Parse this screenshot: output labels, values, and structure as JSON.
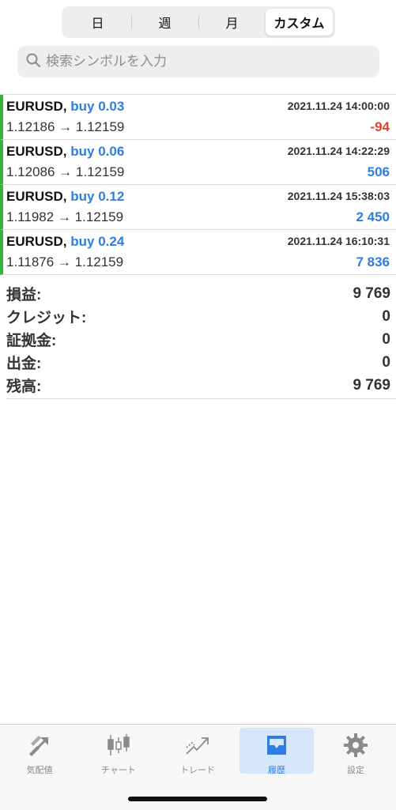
{
  "period_tabs": [
    "日",
    "週",
    "月",
    "カスタム"
  ],
  "search": {
    "placeholder": "検索シンボルを入力"
  },
  "trades": [
    {
      "symbol": "EURUSD,",
      "direction": "buy 0.03",
      "time": "2021.11.24 14:00:00",
      "prices": "1.12186 → 1.12159",
      "profit": "-94"
    },
    {
      "symbol": "EURUSD,",
      "direction": "buy 0.06",
      "time": "2021.11.24 14:22:29",
      "prices": "1.12086 → 1.12159",
      "profit": "506"
    },
    {
      "symbol": "EURUSD,",
      "direction": "buy 0.12",
      "time": "2021.11.24 15:38:03",
      "prices": "1.11982 → 1.12159",
      "profit": "2 450"
    },
    {
      "symbol": "EURUSD,",
      "direction": "buy 0.24",
      "time": "2021.11.24 16:10:31",
      "prices": "1.11876 → 1.12159",
      "profit": "7 836"
    }
  ],
  "summary": [
    {
      "label": "損益:",
      "value": "9 769"
    },
    {
      "label": "クレジット:",
      "value": "0"
    },
    {
      "label": "証拠金:",
      "value": "0"
    },
    {
      "label": "出金:",
      "value": "0"
    },
    {
      "label": "残高:",
      "value": "9 769"
    }
  ],
  "tabbar": [
    {
      "label": "気配値",
      "icon": "quotes-icon"
    },
    {
      "label": "チャート",
      "icon": "candlestick-chart-icon"
    },
    {
      "label": "トレード",
      "icon": "trade-icon"
    },
    {
      "label": "履歴",
      "icon": "history-inbox-icon"
    },
    {
      "label": "設定",
      "icon": "gear-icon"
    }
  ],
  "colors": {
    "buy": "#2f7de1",
    "loss": "#e0442c",
    "profit": "#2f7de1",
    "trade_marker": "#34b33a",
    "active_tab": "#2f7de1"
  }
}
